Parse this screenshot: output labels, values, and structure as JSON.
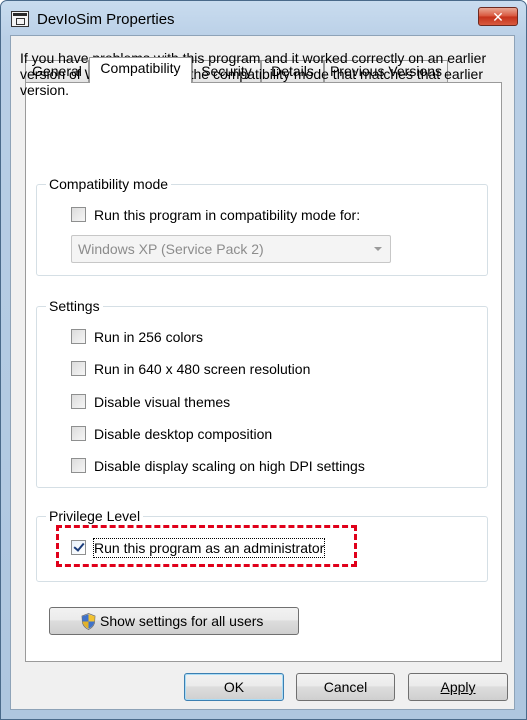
{
  "window": {
    "title": "DevIoSim Properties",
    "close_glyph": "✕"
  },
  "tabs": [
    {
      "label": "General",
      "active": false
    },
    {
      "label": "Compatibility",
      "active": true
    },
    {
      "label": "Security",
      "active": false
    },
    {
      "label": "Details",
      "active": false
    },
    {
      "label": "Previous Versions",
      "active": false
    }
  ],
  "intro_text": "If you have problems with this program and it worked correctly on an earlier version of Windows, select the compatibility mode that matches that earlier version.",
  "compat_mode": {
    "group_label": "Compatibility mode",
    "checkbox": {
      "label": "Run this program in compatibility mode for:",
      "checked": false
    },
    "select": {
      "value": "Windows XP (Service Pack 2)",
      "disabled": true
    }
  },
  "settings": {
    "group_label": "Settings",
    "items": [
      {
        "label": "Run in 256 colors",
        "checked": false
      },
      {
        "label": "Run in 640 x 480 screen resolution",
        "checked": false
      },
      {
        "label": "Disable visual themes",
        "checked": false
      },
      {
        "label": "Disable desktop composition",
        "checked": false
      },
      {
        "label": "Disable display scaling on high DPI settings",
        "checked": false
      }
    ]
  },
  "privilege": {
    "group_label": "Privilege Level",
    "checkbox": {
      "label": "Run this program as an administrator",
      "checked": true
    }
  },
  "show_settings_button": {
    "label": "Show settings for all users",
    "icon": "uac-shield-icon"
  },
  "buttons": {
    "ok": "OK",
    "cancel": "Cancel",
    "apply": "Apply"
  },
  "colors": {
    "highlight": "#e0001a",
    "close": "#c4321a"
  }
}
